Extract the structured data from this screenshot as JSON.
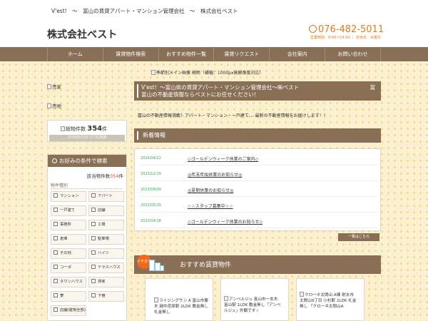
{
  "topbar": {
    "tagline": "V'est!　～　富山の賃貸アパート・マンション管理会社　～　株式会社ベスト"
  },
  "header": {
    "logo": "株式会社ベスト",
    "phone": "076-482-5011",
    "hours": "営業時間：9:00～19:00 ｜ 定休日：水曜日"
  },
  "nav": {
    "items": [
      "ホーム",
      "賃貸物件検索",
      "おすすめ物件一覧",
      "賃貸リクエスト",
      "会社案内",
      "お問い合わせ"
    ]
  },
  "hero": {
    "alt": "季節別メイン画像 梅雨（横幅：1000px高解像度対応）"
  },
  "sidebar": {
    "links": [
      "売家",
      "売地"
    ],
    "count_label": "総物件数",
    "count_value": "354",
    "count_unit": "件",
    "updated": "2024/07/15 17:32更新",
    "search_title": "お好みの条件で検索",
    "hits_prefix": "該当物件数",
    "hits_value": "354",
    "hits_unit": "件",
    "type_title": "物件種別",
    "options": [
      "マンション",
      "アパート",
      "一戸建て",
      "店舗",
      "事務所",
      "工場",
      "倉庫",
      "駐車場",
      "その他",
      "ハイツ",
      "コーポ",
      "テラスハウス",
      "タウンハウス",
      "貸家",
      "寮",
      "下宿",
      "店舗(建物全部)"
    ]
  },
  "main": {
    "title": "V'est！～富山県の賃貸アパート・マンション管理会社～㈱ベスト　　　　　　　　富山の不動産情報ならベストにお任せください！",
    "title_right": "富",
    "intro": "富山の不動産情報満載！アパート・マンション・一戸建て、、最新の不動産情報をお届けします！！",
    "news_title": "新着情報",
    "news": [
      {
        "date": "2024/04/22",
        "title": "◇ゴールデンウィーク休業のご案内◇"
      },
      {
        "date": "2023/12/19",
        "title": "◎年末年始休業のお知らせ◎"
      },
      {
        "date": "2023/08/09",
        "title": "◎夏期休業のお知らせ◎"
      },
      {
        "date": "2023/05/29",
        "title": "☆☆スタッフ募集中☆☆"
      },
      {
        "date": "2023/04/18",
        "title": "◇ゴールデンウィーク休業のお知らせ◇"
      }
    ],
    "more": "一覧はこちら",
    "osusume_badge": "イチオシ",
    "osusume_title": "おすすめ賃貸物件",
    "cards": [
      "ライジングサン A 富山市藤木 越中荏原駅 2LDK 敷金無し 礼金無し",
      "アンベルジュ 富山市一本木 富山駅 1LDK 敷金無し「アンベルジュ」外観です☆",
      "クローネ太閤山 A棟 射水市太閤山9丁目 小杉駅 2LDK 礼金無し 「クローネ太閤山A"
    ]
  }
}
